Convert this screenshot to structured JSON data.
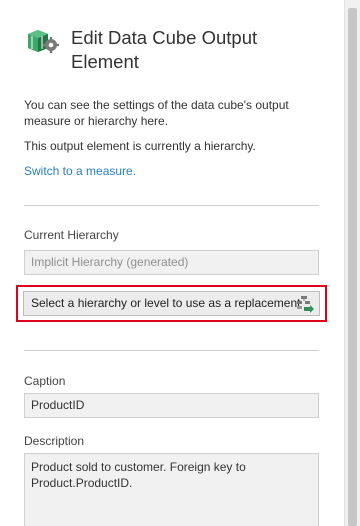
{
  "header": {
    "title": "Edit Data Cube Output Element",
    "icon": "data-cube-settings-icon"
  },
  "intro": {
    "description": "You can see the settings of the data cube's output measure or hierarchy here.",
    "status": "This output element is currently a hierarchy.",
    "switch_link": "Switch to a measure."
  },
  "current_hierarchy": {
    "label": "Current Hierarchy",
    "value": "Implicit Hierarchy (generated)",
    "replace_button": "Select a hierarchy or level to use as a replacement",
    "replace_icon": "hierarchy-replace-icon"
  },
  "caption": {
    "label": "Caption",
    "value": "ProductID"
  },
  "description": {
    "label": "Description",
    "value": "Product sold to customer. Foreign key to Product.ProductID."
  },
  "colors": {
    "link": "#2a7fc1",
    "highlight": "#e0001b",
    "icon_green": "#2f8f55",
    "icon_gray": "#7a7a7a"
  }
}
